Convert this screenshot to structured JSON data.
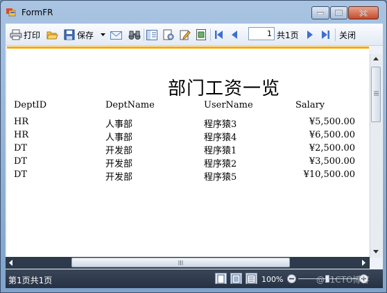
{
  "window": {
    "title": "FormFR",
    "controls": {
      "minimize": "minimize-icon",
      "maximize": "maximize-icon",
      "close": "close-icon"
    }
  },
  "toolbar": {
    "print_label": "打印",
    "save_label": "保存",
    "page_value": "1",
    "page_total": "共1页",
    "close_label": "关闭"
  },
  "report": {
    "title": "部门工资一览",
    "columns": [
      "DeptID",
      "DeptName",
      "UserName",
      "Salary"
    ],
    "rows": [
      [
        "HR",
        "人事部",
        "程序猿3",
        "¥5,500.00"
      ],
      [
        "HR",
        "人事部",
        "程序猿4",
        "¥6,500.00"
      ],
      [
        "DT",
        "开发部",
        "程序猿1",
        "¥2,500.00"
      ],
      [
        "DT",
        "开发部",
        "程序猿2",
        "¥3,500.00"
      ],
      [
        "DT",
        "开发部",
        "程序猿5",
        "¥10,500.00"
      ]
    ]
  },
  "statusbar": {
    "page_info": "第1页共1页",
    "zoom": "100%",
    "watermark": "@51CTO博客"
  },
  "colors": {
    "accent": "#f6a800",
    "statusbar": "#263244"
  }
}
